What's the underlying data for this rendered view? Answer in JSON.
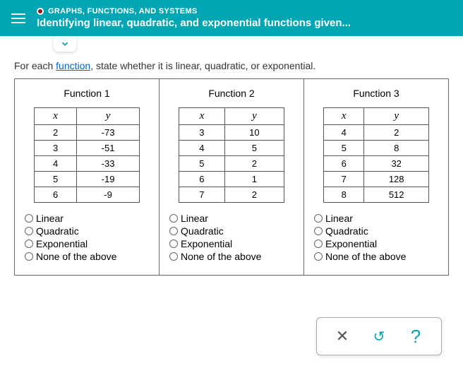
{
  "header": {
    "category": "GRAPHS, FUNCTIONS, AND SYSTEMS",
    "title": "Identifying linear, quadratic, and exponential functions given..."
  },
  "prompt": {
    "before": "For each ",
    "link": "function",
    "after": ", state whether it is linear, quadratic, or exponential."
  },
  "functions": [
    {
      "title": "Function 1",
      "xheader": "x",
      "yheader": "y",
      "rows": [
        {
          "x": "2",
          "y": "-73"
        },
        {
          "x": "3",
          "y": "-51"
        },
        {
          "x": "4",
          "y": "-33"
        },
        {
          "x": "5",
          "y": "-19"
        },
        {
          "x": "6",
          "y": "-9"
        }
      ]
    },
    {
      "title": "Function 2",
      "xheader": "x",
      "yheader": "y",
      "rows": [
        {
          "x": "3",
          "y": "10"
        },
        {
          "x": "4",
          "y": "5"
        },
        {
          "x": "5",
          "y": "2"
        },
        {
          "x": "6",
          "y": "1"
        },
        {
          "x": "7",
          "y": "2"
        }
      ]
    },
    {
      "title": "Function 3",
      "xheader": "x",
      "yheader": "y",
      "rows": [
        {
          "x": "4",
          "y": "2"
        },
        {
          "x": "5",
          "y": "8"
        },
        {
          "x": "6",
          "y": "32"
        },
        {
          "x": "7",
          "y": "128"
        },
        {
          "x": "8",
          "y": "512"
        }
      ]
    }
  ],
  "options": {
    "o1": "Linear",
    "o2": "Quadratic",
    "o3": "Exponential",
    "o4": "None of the above"
  },
  "toolbar": {
    "close": "✕",
    "reset": "↺",
    "help": "?"
  }
}
